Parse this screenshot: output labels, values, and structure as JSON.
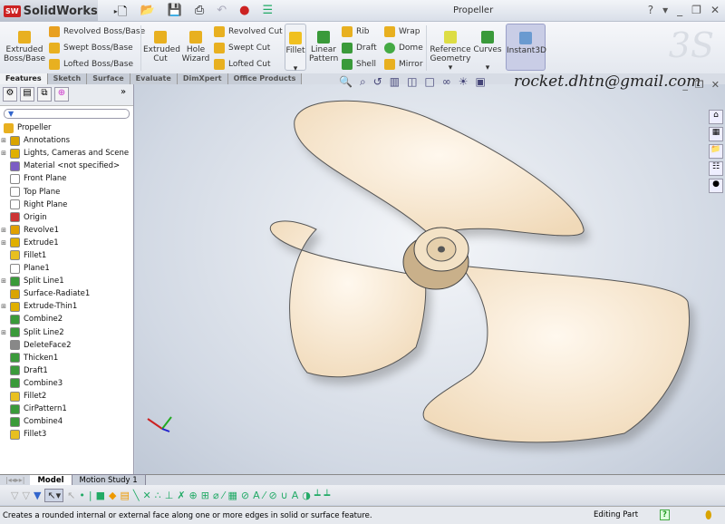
{
  "app": {
    "name": "SolidWorks",
    "logo_text": "SW",
    "document_title": "Propeller"
  },
  "window_controls": [
    "?",
    "-",
    "_",
    "❐",
    "✕"
  ],
  "ribbon": {
    "extruded_boss": "Extruded Boss/Base",
    "revolved_boss": "Revolved Boss/Base",
    "swept_boss": "Swept Boss/Base",
    "lofted_boss": "Lofted Boss/Base",
    "extruded_cut": "Extruded Cut",
    "hole_wizard": "Hole Wizard",
    "revolved_cut": "Revolved Cut",
    "swept_cut": "Swept Cut",
    "lofted_cut": "Lofted Cut",
    "fillet": "Fillet",
    "linear_pattern": "Linear Pattern",
    "rib": "Rib",
    "draft": "Draft",
    "shell": "Shell",
    "wrap": "Wrap",
    "dome": "Dome",
    "mirror": "Mirror",
    "reference_geometry": "Reference Geometry",
    "curves": "Curves",
    "instant3d": "Instant3D"
  },
  "tabs": [
    "Features",
    "Sketch",
    "Surface",
    "Evaluate",
    "DimXpert",
    "Office Products"
  ],
  "tree": {
    "root": "Propeller",
    "items": [
      {
        "label": "Annotations",
        "exp": "+",
        "color": "#d9a400"
      },
      {
        "label": "Lights, Cameras and Scene",
        "exp": "+",
        "color": "#e0b000"
      },
      {
        "label": "Material <not specified>",
        "exp": "",
        "color": "#7b5cc4"
      },
      {
        "label": "Front Plane",
        "exp": "",
        "color": "#ffffff"
      },
      {
        "label": "Top Plane",
        "exp": "",
        "color": "#ffffff"
      },
      {
        "label": "Right Plane",
        "exp": "",
        "color": "#ffffff"
      },
      {
        "label": "Origin",
        "exp": "",
        "color": "#c33"
      },
      {
        "label": "Revolve1",
        "exp": "+",
        "color": "#e0a000"
      },
      {
        "label": "Extrude1",
        "exp": "+",
        "color": "#e0b000"
      },
      {
        "label": "Fillet1",
        "exp": "",
        "color": "#e8c020"
      },
      {
        "label": "Plane1",
        "exp": "",
        "color": "#ffffff"
      },
      {
        "label": "Split Line1",
        "exp": "+",
        "color": "#3a9a3a"
      },
      {
        "label": "Surface-Radiate1",
        "exp": "",
        "color": "#d9a400"
      },
      {
        "label": "Extrude-Thin1",
        "exp": "+",
        "color": "#e0b000"
      },
      {
        "label": "Combine2",
        "exp": "",
        "color": "#3a9a3a"
      },
      {
        "label": "Split Line2",
        "exp": "+",
        "color": "#3a9a3a"
      },
      {
        "label": "DeleteFace2",
        "exp": "",
        "color": "#888"
      },
      {
        "label": "Thicken1",
        "exp": "",
        "color": "#3a9a3a"
      },
      {
        "label": "Draft1",
        "exp": "",
        "color": "#3a9a3a"
      },
      {
        "label": "Combine3",
        "exp": "",
        "color": "#3a9a3a"
      },
      {
        "label": "Fillet2",
        "exp": "",
        "color": "#e8c020"
      },
      {
        "label": "CirPattern1",
        "exp": "",
        "color": "#3a9a3a"
      },
      {
        "label": "Combine4",
        "exp": "",
        "color": "#3a9a3a"
      },
      {
        "label": "Fillet3",
        "exp": "",
        "color": "#e8c020"
      }
    ]
  },
  "viewport": {
    "watermark_email": "rocket.dhtn@gmail.com",
    "model_color": "#f6e3c8"
  },
  "bottom_tabs": [
    "Model",
    "Motion Study 1"
  ],
  "status": {
    "message": "Creates a rounded internal or external face along one or more edges in solid or surface feature.",
    "mode": "Editing Part",
    "help": "?"
  }
}
